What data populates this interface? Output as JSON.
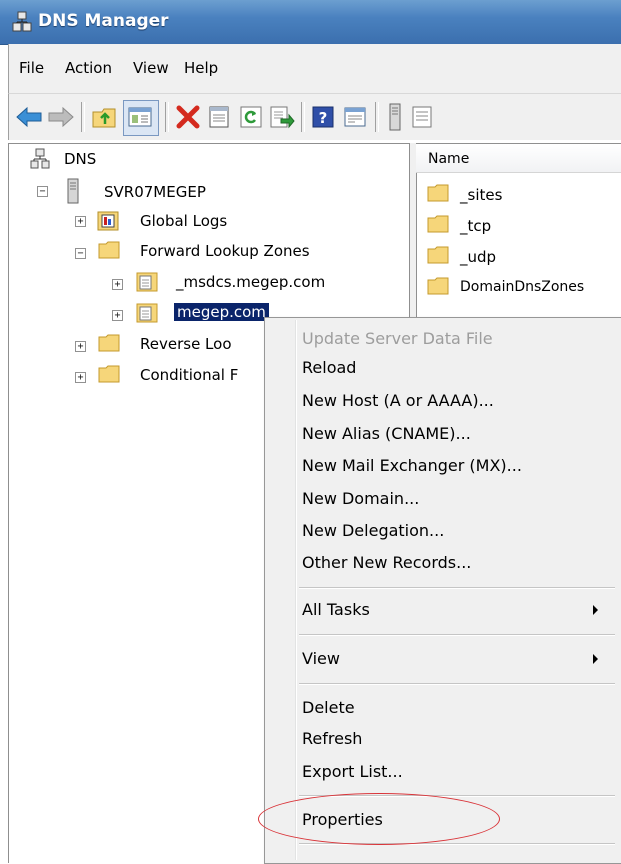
{
  "window": {
    "title": "DNS Manager",
    "icon": "dns-manager-icon"
  },
  "menubar": {
    "items": [
      "File",
      "Action",
      "View",
      "Help"
    ]
  },
  "toolbar": {
    "buttons": [
      "back-icon",
      "forward-icon",
      "up-folder-icon",
      "show-hide-tree-icon",
      "delete-icon",
      "properties-icon",
      "refresh-icon",
      "export-list-icon",
      "help-icon",
      "filter-icon",
      "server-icon",
      "list-icon"
    ]
  },
  "tree": {
    "root": "DNS",
    "server": "SVR07MEGEP",
    "global_logs": "Global Logs",
    "forward_zones": "Forward Lookup Zones",
    "msdcs_zone": "_msdcs.megep.com",
    "megep_zone": "megep.com",
    "reverse_zones": "Reverse Loo",
    "conditional": "Conditional F"
  },
  "list": {
    "header": "Name",
    "items": [
      "_sites",
      "_tcp",
      "_udp",
      "DomainDnsZones"
    ]
  },
  "context_menu": {
    "update_server": "Update Server Data File",
    "reload": "Reload",
    "new_host": "New Host (A or AAAA)...",
    "new_alias": "New Alias (CNAME)...",
    "new_mx": "New Mail Exchanger (MX)...",
    "new_domain": "New Domain...",
    "new_delegation": "New Delegation...",
    "other_records": "Other New Records...",
    "all_tasks": "All Tasks",
    "view": "View",
    "delete": "Delete",
    "refresh": "Refresh",
    "export_list": "Export List...",
    "properties": "Properties"
  },
  "colors": {
    "titlebar": "#4a81bf",
    "selection": "#0a246a",
    "annotation": "#d9353a",
    "folder": "#f6d67a"
  }
}
